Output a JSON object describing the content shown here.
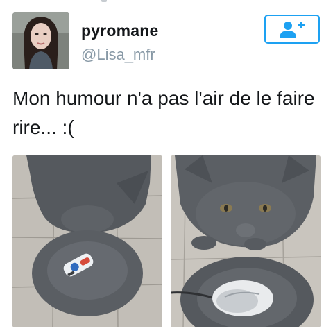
{
  "tweet": {
    "author": {
      "display_name": "pyromane",
      "handle": "@Lisa_mfr"
    },
    "text": "Mon humour n'a pas l'air de le faire rire... :(",
    "follow_icon": "add-user-icon",
    "media_count": 2
  },
  "colors": {
    "accent": "#1da1f2",
    "name": "#14171a",
    "handle": "#8899a6"
  }
}
